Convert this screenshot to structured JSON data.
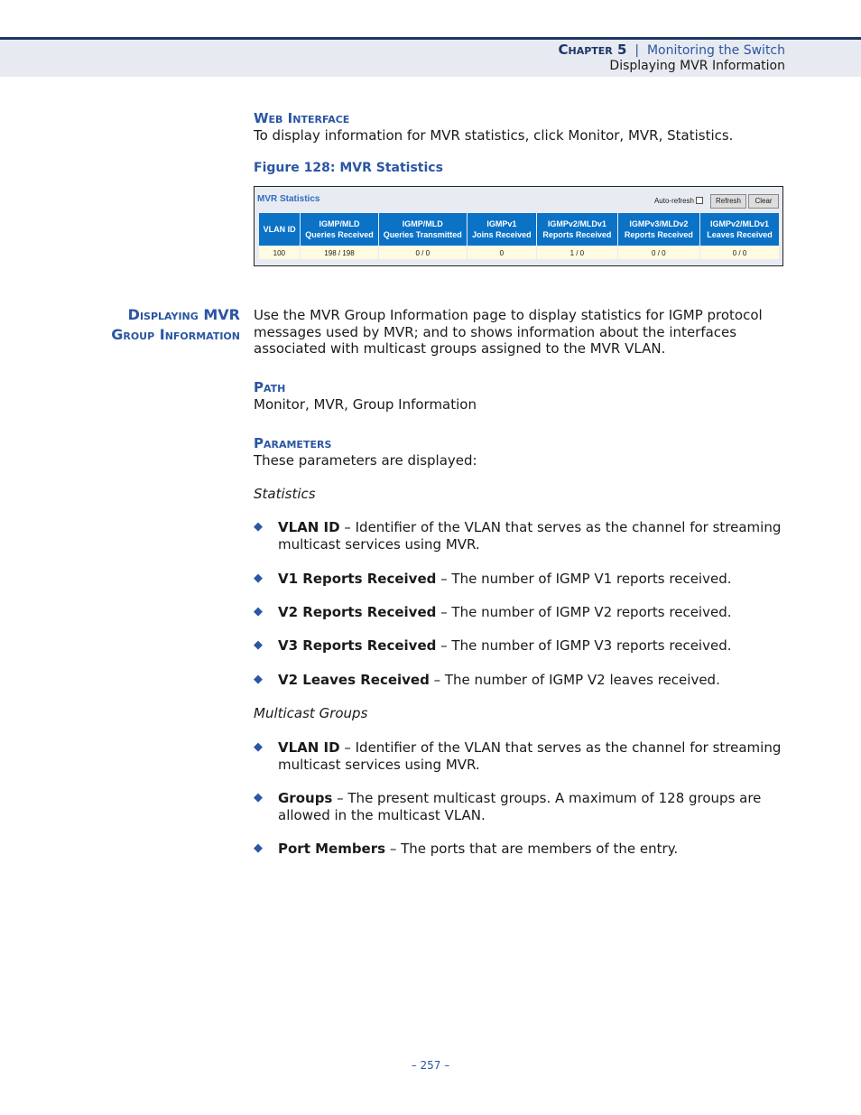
{
  "header": {
    "chapter": "Chapter 5",
    "separator": "|",
    "chapter_title": "Monitoring the Switch",
    "section": "Displaying MVR Information"
  },
  "web_interface": {
    "heading": "Web Interface",
    "text": "To display information for MVR statistics, click Monitor, MVR, Statistics."
  },
  "figure": {
    "caption": "Figure 128:  MVR Statistics",
    "title": "MVR Statistics",
    "auto_refresh_label": "Auto-refresh",
    "auto_refresh_checked": false,
    "refresh_label": "Refresh",
    "clear_label": "Clear",
    "columns": [
      [
        "VLAN ID",
        ""
      ],
      [
        "IGMP/MLD",
        "Queries Received"
      ],
      [
        "IGMP/MLD",
        "Queries Transmitted"
      ],
      [
        "IGMPv1",
        "Joins Received"
      ],
      [
        "IGMPv2/MLDv1",
        "Reports Received"
      ],
      [
        "IGMPv3/MLDv2",
        "Reports Received"
      ],
      [
        "IGMPv2/MLDv1",
        "Leaves Received"
      ]
    ],
    "row": [
      "100",
      "198 / 198",
      "0 / 0",
      "0",
      "1 / 0",
      "0 / 0",
      "0 / 0"
    ]
  },
  "section": {
    "heading_line1": "Displaying MVR",
    "heading_line2": "Group Information",
    "intro": "Use the MVR Group Information page to display statistics for IGMP protocol messages used by MVR; and to shows information about the interfaces associated with multicast groups assigned to the MVR VLAN."
  },
  "path": {
    "heading": "Path",
    "text": "Monitor, MVR, Group Information"
  },
  "parameters": {
    "heading": "Parameters",
    "text": "These parameters are displayed:",
    "statistics_label": "Statistics",
    "statistics": [
      {
        "term": "VLAN ID",
        "desc": " – Identifier of the VLAN that serves as the channel for streaming multicast services using MVR."
      },
      {
        "term": "V1 Reports Received",
        "desc": " – The number of IGMP V1 reports received."
      },
      {
        "term": "V2 Reports Received",
        "desc": " – The number of IGMP V2 reports received."
      },
      {
        "term": "V3 Reports Received",
        "desc": " – The number of IGMP V3 reports received."
      },
      {
        "term": "V2 Leaves Received",
        "desc": " – The number of IGMP V2 leaves received."
      }
    ],
    "groups_label": "Multicast Groups",
    "groups": [
      {
        "term": "VLAN ID",
        "desc": " – Identifier of the VLAN that serves as the channel for streaming multicast services using MVR."
      },
      {
        "term": "Groups",
        "desc": " – The present multicast groups. A maximum of 128 groups are allowed in the multicast VLAN."
      },
      {
        "term": "Port Members",
        "desc": " – The ports that are members of the entry."
      }
    ]
  },
  "footer": {
    "page": "–  257  –"
  }
}
